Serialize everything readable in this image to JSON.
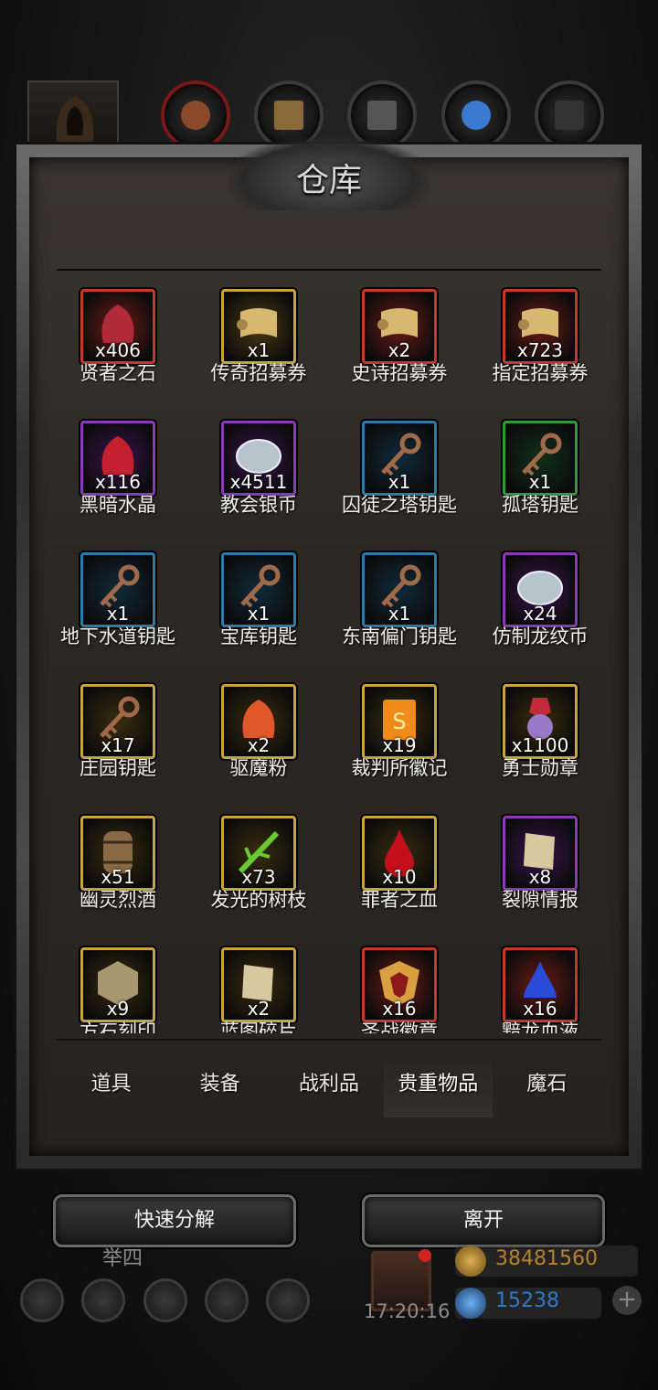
{
  "title": "仓库",
  "items": [
    {
      "name": "贤者之石",
      "count": "x406",
      "frame": "#c5382a",
      "bg": "#6a1a15",
      "art": "#b02a3a",
      "icon": "red-stone-icon"
    },
    {
      "name": "传奇招募券",
      "count": "x1",
      "frame": "#c9a43a",
      "bg": "#4a3a12",
      "art": "#d8b870",
      "icon": "scroll-icon"
    },
    {
      "name": "史诗招募券",
      "count": "x2",
      "frame": "#c5382a",
      "bg": "#6a1a15",
      "art": "#d8b870",
      "icon": "scroll-icon"
    },
    {
      "name": "指定招募券",
      "count": "x723",
      "frame": "#c5382a",
      "bg": "#6a1a15",
      "art": "#d8b870",
      "icon": "scroll-icon"
    },
    {
      "name": "黑暗水晶",
      "count": "x116",
      "frame": "#8a3ab5",
      "bg": "#3a1250",
      "art": "#c42030",
      "icon": "dark-crystal-icon"
    },
    {
      "name": "教会银币",
      "count": "x4511",
      "frame": "#8a3ab5",
      "bg": "#3a1250",
      "art": "#b8c4cc",
      "icon": "silver-coin-icon"
    },
    {
      "name": "囚徒之塔钥匙",
      "count": "x1",
      "frame": "#2b7aa8",
      "bg": "#102a3a",
      "art": "#a06a4a",
      "icon": "key-icon"
    },
    {
      "name": "孤塔钥匙",
      "count": "x1",
      "frame": "#2f9a3a",
      "bg": "#10301a",
      "art": "#a06a4a",
      "icon": "key-icon"
    },
    {
      "name": "地下水道钥匙",
      "count": "x1",
      "frame": "#2b7aa8",
      "bg": "#102a3a",
      "art": "#a06a4a",
      "icon": "key-icon"
    },
    {
      "name": "宝库钥匙",
      "count": "x1",
      "frame": "#2b7aa8",
      "bg": "#102a3a",
      "art": "#a06a4a",
      "icon": "key-icon"
    },
    {
      "name": "东南偏门钥匙",
      "count": "x1",
      "frame": "#2b7aa8",
      "bg": "#102a3a",
      "art": "#a06a4a",
      "icon": "key-icon"
    },
    {
      "name": "仿制龙纹币",
      "count": "x24",
      "frame": "#8a3ab5",
      "bg": "#3a1250",
      "art": "#b8c4cc",
      "icon": "dragon-coin-icon"
    },
    {
      "name": "庄园钥匙",
      "count": "x17",
      "frame": "#c9a43a",
      "bg": "#3a2c0e",
      "art": "#a06a4a",
      "icon": "key-icon"
    },
    {
      "name": "驱魔粉",
      "count": "x2",
      "frame": "#c9a43a",
      "bg": "#3a2c0e",
      "art": "#e0582a",
      "icon": "powder-icon"
    },
    {
      "name": "裁判所徽记",
      "count": "x19",
      "frame": "#c9a43a",
      "bg": "#3a2c0e",
      "art": "#f08a1a",
      "icon": "emblem-book-icon"
    },
    {
      "name": "勇士勋章",
      "count": "x1100",
      "frame": "#c9a43a",
      "bg": "#3a2c0e",
      "art": "#9a7ac8",
      "icon": "medal-icon"
    },
    {
      "name": "幽灵烈酒",
      "count": "x51",
      "frame": "#c9a43a",
      "bg": "#3a2c0e",
      "art": "#8a6a44",
      "icon": "barrel-icon"
    },
    {
      "name": "发光的树枝",
      "count": "x73",
      "frame": "#c9a43a",
      "bg": "#3a2c0e",
      "art": "#6ac830",
      "icon": "branch-icon"
    },
    {
      "name": "罪者之血",
      "count": "x10",
      "frame": "#c9a43a",
      "bg": "#3a2c0e",
      "art": "#c4101a",
      "icon": "blood-drop-icon"
    },
    {
      "name": "裂隙情报",
      "count": "x8",
      "frame": "#8a3ab5",
      "bg": "#3a1250",
      "art": "#d8c8a0",
      "icon": "paper-icon"
    },
    {
      "name": "方石刻印",
      "count": "x9",
      "frame": "#c9a43a",
      "bg": "#3a2c0e",
      "art": "#a89870",
      "icon": "stone-seal-icon"
    },
    {
      "name": "蓝图碎片",
      "count": "x2",
      "frame": "#c9a43a",
      "bg": "#3a2c0e",
      "art": "#d8c8a0",
      "icon": "paper-icon"
    },
    {
      "name": "圣战徽章",
      "count": "x16",
      "frame": "#c5382a",
      "bg": "#6a1a15",
      "art": "#d8a040",
      "icon": "crusade-badge-icon"
    },
    {
      "name": "黯龙血液",
      "count": "x16",
      "frame": "#c5382a",
      "bg": "#6a1a15",
      "art": "#2a4ad8",
      "icon": "blue-drop-icon"
    }
  ],
  "tabs": [
    "道具",
    "装备",
    "战利品",
    "贵重物品",
    "魔石"
  ],
  "buttons": {
    "decompose": "快速分解",
    "leave": "离开"
  },
  "status": {
    "name": "举四",
    "timer": "17:20:16",
    "gold": "38481560",
    "gems": "15238",
    "plus": "+"
  },
  "colors": {
    "gold_text": "#b9812c",
    "gem_text": "#2f7ac8"
  }
}
